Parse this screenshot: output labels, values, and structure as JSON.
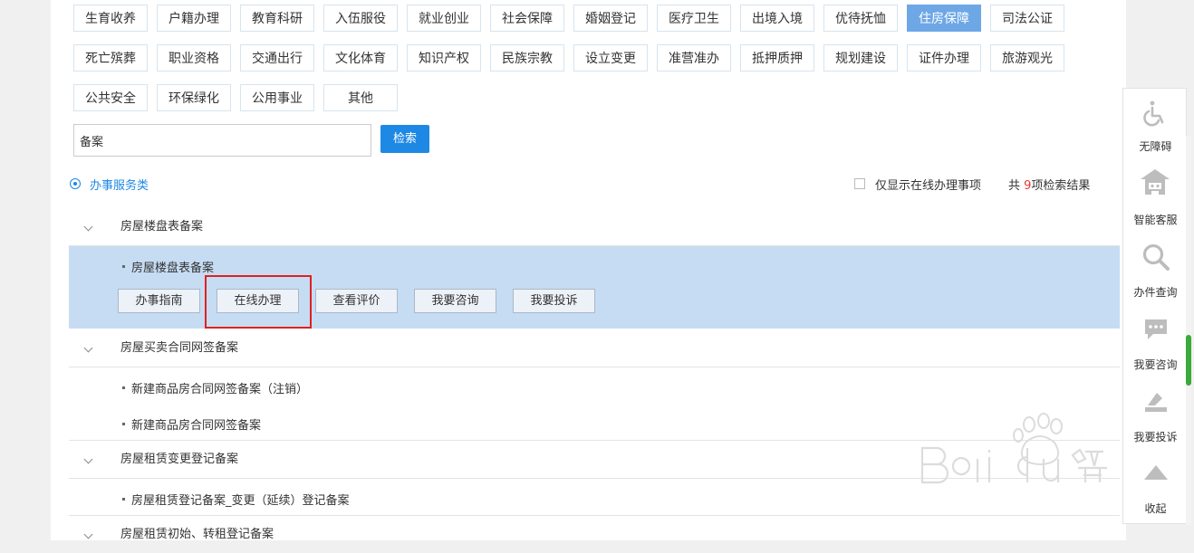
{
  "categories": [
    {
      "label": "生育收养",
      "active": false
    },
    {
      "label": "户籍办理",
      "active": false
    },
    {
      "label": "教育科研",
      "active": false
    },
    {
      "label": "入伍服役",
      "active": false
    },
    {
      "label": "就业创业",
      "active": false
    },
    {
      "label": "社会保障",
      "active": false
    },
    {
      "label": "婚姻登记",
      "active": false
    },
    {
      "label": "医疗卫生",
      "active": false
    },
    {
      "label": "出境入境",
      "active": false
    },
    {
      "label": "优待抚恤",
      "active": false
    },
    {
      "label": "住房保障",
      "active": true
    },
    {
      "label": "司法公证",
      "active": false
    },
    {
      "label": "死亡殡葬",
      "active": false
    },
    {
      "label": "职业资格",
      "active": false
    },
    {
      "label": "交通出行",
      "active": false
    },
    {
      "label": "文化体育",
      "active": false
    },
    {
      "label": "知识产权",
      "active": false
    },
    {
      "label": "民族宗教",
      "active": false
    },
    {
      "label": "设立变更",
      "active": false
    },
    {
      "label": "准营准办",
      "active": false
    },
    {
      "label": "抵押质押",
      "active": false
    },
    {
      "label": "规划建设",
      "active": false
    },
    {
      "label": "证件办理",
      "active": false
    },
    {
      "label": "旅游观光",
      "active": false
    },
    {
      "label": "公共安全",
      "active": false
    },
    {
      "label": "环保绿化",
      "active": false
    },
    {
      "label": "公用事业",
      "active": false
    },
    {
      "label": "其他",
      "active": false
    }
  ],
  "search": {
    "value": "备案",
    "button_label": "检索"
  },
  "service_type": {
    "label": "办事服务类"
  },
  "online_only": {
    "label": "仅显示在线办理事项",
    "checked": false
  },
  "results": {
    "prefix": "共 ",
    "count": "9",
    "suffix": "项检索结果"
  },
  "groups": [
    {
      "title": "房屋楼盘表备案",
      "items": [
        "房屋楼盘表备案"
      ]
    },
    {
      "title": "房屋买卖合同网签备案",
      "items": [
        "新建商品房合同网签备案（注销）",
        "新建商品房合同网签备案"
      ]
    },
    {
      "title": "房屋租赁变更登记备案",
      "items": [
        "房屋租赁登记备案_变更（延续）登记备案"
      ]
    },
    {
      "title": "房屋租赁初始、转租登记备案",
      "items": []
    }
  ],
  "actions": [
    "办事指南",
    "在线办理",
    "查看评价",
    "我要咨询",
    "我要投诉"
  ],
  "toolbar": [
    {
      "label": "无障碍",
      "icon": "wheelchair-icon"
    },
    {
      "label": "智能客服",
      "icon": "robot-icon"
    },
    {
      "label": "办件查询",
      "icon": "magnifier-icon"
    },
    {
      "label": "我要咨询",
      "icon": "chat-icon"
    },
    {
      "label": "我要投诉",
      "icon": "complaint-icon"
    },
    {
      "label": "收起",
      "icon": "collapse-up-icon"
    }
  ],
  "colors": {
    "accent": "#1e88e5",
    "active_tag": "#6ea7e6",
    "highlight": "#c6dcf3",
    "annotation": "#e02020"
  }
}
